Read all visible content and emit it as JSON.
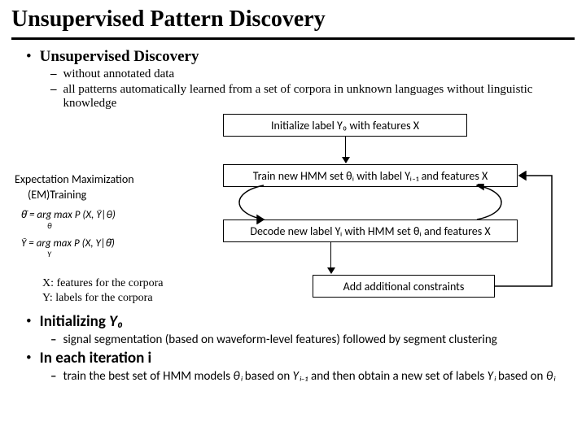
{
  "title": "Unsupervised Pattern Discovery",
  "section1": {
    "heading": "Unsupervised  Discovery",
    "points": [
      "without annotated data",
      "all patterns automatically learned from a set of corpora in unknown languages without linguistic knowledge"
    ]
  },
  "diagram": {
    "box_init": "Initialize label Y₀  with features X",
    "box_train": "Train new HMM set θᵢ with label Yᵢ₋₁ and features X",
    "box_decode": "Decode new label Yᵢ with HMM set θᵢ and features X",
    "box_constraints": "Add additional constraints",
    "em_title": "Expectation Maximization",
    "em_sub": "(EM)Training",
    "eq1_lhs": "θ̄ =",
    "eq1_rhs": "arg max P (X, Ȳ|θ)",
    "eq1_under": "θ",
    "eq2_lhs": "Ȳ =",
    "eq2_rhs": "arg max P (X, Y|θ̄)",
    "eq2_under": "Y",
    "def_x": "X: features for the corpora",
    "def_y": "Y: labels for the corpora"
  },
  "section2": {
    "heading_init": "Initializing ",
    "heading_init_math": "Y₀",
    "init_sub": "signal segmentation (based on waveform-level features) followed by segment clustering",
    "heading_iter": "In each iteration i",
    "iter_sub_pre": "train the best set of HMM models ",
    "iter_theta_i": "θᵢ",
    "iter_mid": " based on ",
    "iter_y_im1": "Yᵢ₋₁",
    "iter_post": " and then obtain a new set of labels ",
    "iter_y_i": "Yᵢ",
    "iter_end": " based on ",
    "iter_theta_i2": "θᵢ"
  }
}
